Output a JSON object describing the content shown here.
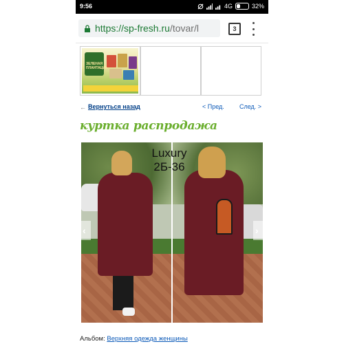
{
  "status_bar": {
    "time": "9:56",
    "network": "4G",
    "battery": "32%"
  },
  "browser": {
    "url_host": "https://sp-fresh.ru",
    "url_path": "/tovar/l",
    "tab_count": "3"
  },
  "thumbnail": {
    "brand": "ЗЕЛЕНАЯ ПЛАНТАЦИЯ"
  },
  "nav": {
    "back_arrow": "←",
    "back_label": "Вернуться назад",
    "prev_label": "< Пред.",
    "next_label": "След. >"
  },
  "page_title": "куртка распродажа",
  "photo": {
    "watermark_line1": "Luxury",
    "watermark_line2": "2Б-36"
  },
  "album": {
    "label": "Альбом:",
    "link": "Верхняя одежда женщины"
  },
  "colors": {
    "url_green": "#1d7a35",
    "title_green": "#6aae2d",
    "link_blue": "#0b59b8",
    "back_link": "#003e87",
    "coat": "#6a1c25"
  }
}
